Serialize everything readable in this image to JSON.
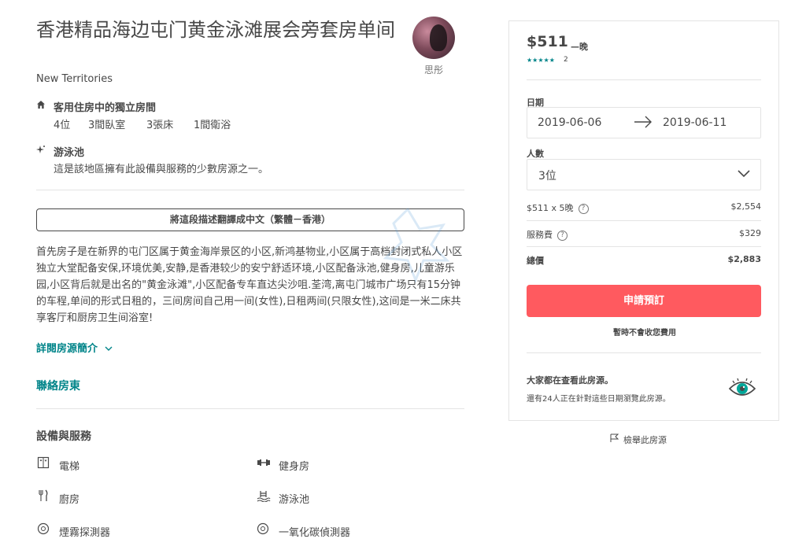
{
  "listing": {
    "title": "香港精品海边屯门黄金泳滩展会旁套房单间",
    "location": "New Territories",
    "host_name": "思彤"
  },
  "highlights": [
    {
      "icon": "home-icon",
      "title": "客用住房中的獨立房間",
      "details": [
        "4位",
        "3間臥室",
        "3張床",
        "1間衛浴"
      ]
    },
    {
      "icon": "sparkle-icon",
      "title": "游泳池",
      "subtitle": "這是該地區擁有此設備與服務的少數房源之一。"
    }
  ],
  "translate_button": "將這段描述翻譯成中文（繁體－香港）",
  "description": "首先房子是在新界的屯门区属于黄金海岸景区的小区,新鸿基物业,小区属于高档封闭式私人小区独立大堂配备安保,环境优美,安静,是香港较少的安宁舒适环境,小区配备泳池,健身房,儿童游乐园,小区背后就是出名的\"黄金泳滩\",小区配备专车直达尖沙咀.荃湾,离屯门城市广场只有15分钟的车程,单间的形式日租的，三间房间自己用一间(女性),日租两间(只限女性),这间是一米二床共享客厅和厨房卫生间浴室!",
  "links": {
    "read_more": "詳閱房源簡介",
    "contact_host": "聯絡房東"
  },
  "amenities": {
    "title": "設備與服務",
    "items": [
      {
        "icon": "elevator-icon",
        "label": "電梯"
      },
      {
        "icon": "dumbbell-icon",
        "label": "健身房"
      },
      {
        "icon": "kitchen-icon",
        "label": "廚房"
      },
      {
        "icon": "pool-icon",
        "label": "游泳池"
      },
      {
        "icon": "smoke-detector-icon",
        "label": "煙霧探測器"
      },
      {
        "icon": "co-detector-icon",
        "label": "一氧化碳偵測器"
      }
    ]
  },
  "booking": {
    "price": "$511",
    "per_night": "—晚",
    "stars": "★★★★★",
    "review_count": "2",
    "dates_label": "日期",
    "checkin": "2019-06-06",
    "checkout": "2019-06-11",
    "guests_label": "人數",
    "guests_value": "3位",
    "nightly_label": "$511 x 5晚",
    "nightly_value": "$2,554",
    "service_label": "服務費",
    "service_value": "$329",
    "total_label": "總價",
    "total_value": "$2,883",
    "book_button": "申請預訂",
    "no_charge": "暫時不會收您費用",
    "views_title": "大家都在查看此房源。",
    "views_sub": "還有24人正在針對這些日期瀏覽此房源。"
  },
  "report_link": "檢舉此房源",
  "colors": {
    "accent": "#ff5a5f",
    "teal": "#008489",
    "text": "#484848",
    "border": "#e4e4e4"
  }
}
